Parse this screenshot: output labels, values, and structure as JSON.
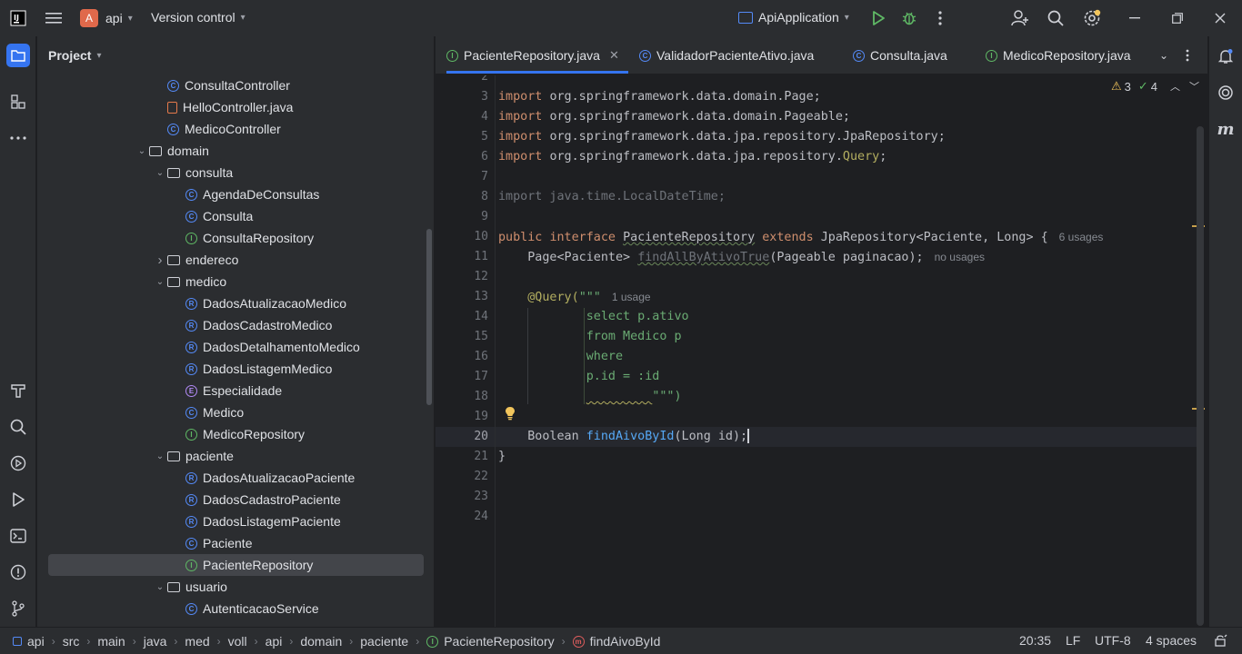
{
  "titlebar": {
    "project_badge": "A",
    "project_name": "api",
    "vcs_label": "Version control",
    "run_config": "ApiApplication",
    "colors": {
      "badge": "#e0694b",
      "run": "#5fb865",
      "debug": "#5fb865",
      "settings_dot": "#f2c55c"
    }
  },
  "project_panel": {
    "title": "Project",
    "items": [
      {
        "label": "ConsultaController",
        "icon": "class"
      },
      {
        "label": "HelloController.java",
        "icon": "java-file"
      },
      {
        "label": "MedicoController",
        "icon": "class"
      },
      {
        "label": "domain",
        "icon": "folder"
      },
      {
        "label": "consulta",
        "icon": "folder"
      },
      {
        "label": "AgendaDeConsultas",
        "icon": "class"
      },
      {
        "label": "Consulta",
        "icon": "class"
      },
      {
        "label": "ConsultaRepository",
        "icon": "interface"
      },
      {
        "label": "endereco",
        "icon": "folder"
      },
      {
        "label": "medico",
        "icon": "folder"
      },
      {
        "label": "DadosAtualizacaoMedico",
        "icon": "record"
      },
      {
        "label": "DadosCadastroMedico",
        "icon": "record"
      },
      {
        "label": "DadosDetalhamentoMedico",
        "icon": "record"
      },
      {
        "label": "DadosListagemMedico",
        "icon": "record"
      },
      {
        "label": "Especialidade",
        "icon": "enum"
      },
      {
        "label": "Medico",
        "icon": "class"
      },
      {
        "label": "MedicoRepository",
        "icon": "interface"
      },
      {
        "label": "paciente",
        "icon": "folder"
      },
      {
        "label": "DadosAtualizacaoPaciente",
        "icon": "record"
      },
      {
        "label": "DadosCadastroPaciente",
        "icon": "record"
      },
      {
        "label": "DadosListagemPaciente",
        "icon": "record"
      },
      {
        "label": "Paciente",
        "icon": "class"
      },
      {
        "label": "PacienteRepository",
        "icon": "interface"
      },
      {
        "label": "usuario",
        "icon": "folder"
      },
      {
        "label": "AutenticacaoService",
        "icon": "class"
      }
    ]
  },
  "tabs": [
    {
      "label": "PacienteRepository.java",
      "icon": "interface"
    },
    {
      "label": "ValidadorPacienteAtivo.java",
      "icon": "class"
    },
    {
      "label": "Consulta.java",
      "icon": "class"
    },
    {
      "label": "MedicoRepository.java",
      "icon": "interface"
    }
  ],
  "inspections": {
    "warnings": "3",
    "weak_warnings": "4"
  },
  "editor": {
    "line_numbers": [
      "2",
      "3",
      "4",
      "5",
      "6",
      "7",
      "8",
      "9",
      "10",
      "11",
      "12",
      "13",
      "14",
      "15",
      "16",
      "17",
      "18",
      "19",
      "20",
      "21",
      "22",
      "23",
      "24"
    ],
    "code": {
      "l3": "org.springframework.data.domain.Page;",
      "l4": "org.springframework.data.domain.Pageable;",
      "l5": "org.springframework.data.jpa.repository.JpaRepository;",
      "l6a": "org.springframework.data.jpa.repository.",
      "l6b": "Query",
      "l8": "import java.time.LocalDateTime;",
      "l10_name": "PacienteRepository",
      "l10_rest": "JpaRepository<Paciente, Long> {",
      "l10_hint": "6 usages",
      "l11_type": "Page<Paciente>",
      "l11_method": "findAllByAtivoTrue",
      "l11_rest": "(Pageable paginacao);",
      "l11_hint": "no usages",
      "l13_ann": "@Query(",
      "l13_str": "\"\"\"",
      "l13_hint": "1 usage",
      "l14": "select p.ativo",
      "l15": "from Medico p",
      "l16": "where",
      "l17": "p.id = :id",
      "l18": "\"\"\")",
      "l20_type": "Boolean",
      "l20_method": "findAivoById",
      "l20_rest": "(Long id);",
      "l21": "}",
      "kw_import": "import",
      "kw_public": "public",
      "kw_interface": "interface",
      "kw_extends": "extends"
    }
  },
  "statusbar": {
    "breadcrumbs": [
      "api",
      "src",
      "main",
      "java",
      "med",
      "voll",
      "api",
      "domain",
      "paciente",
      "PacienteRepository",
      "findAivoById"
    ],
    "position": "20:35",
    "line_sep": "LF",
    "encoding": "UTF-8",
    "indent": "4 spaces"
  }
}
